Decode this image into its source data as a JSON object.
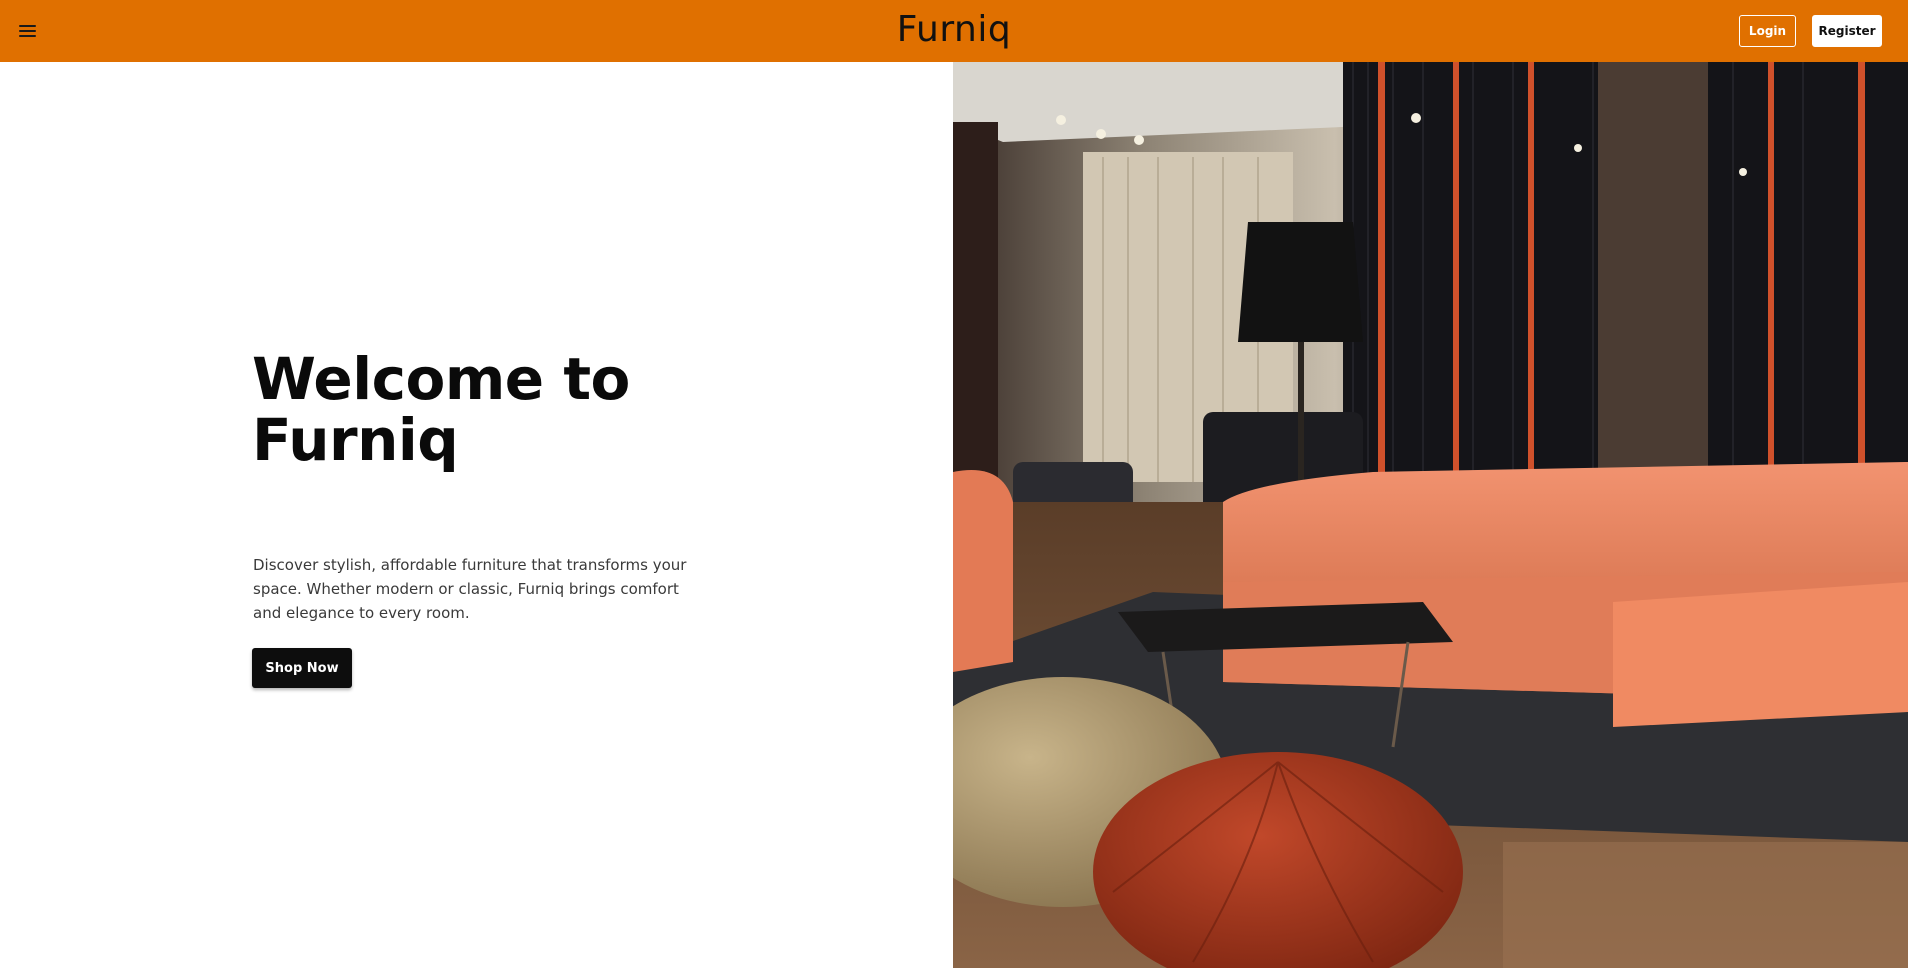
{
  "header": {
    "brand": "Furniq",
    "login_label": "Login",
    "register_label": "Register",
    "menu_icon": "hamburger-menu-icon",
    "background": "#e07000"
  },
  "hero": {
    "title": "Welcome to Furniq",
    "description": "Discover stylish, affordable furniture that transforms your space. Whether modern or classic, Furniq brings comfort and elegance to every room.",
    "cta_label": "Shop Now",
    "image_alt": "Furniture showroom interior with orange leather sectional sofa, poufs and floor lamp"
  }
}
